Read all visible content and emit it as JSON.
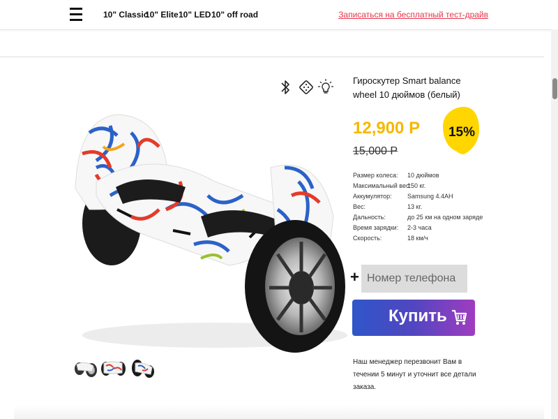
{
  "header": {
    "nav": [
      "10\" Classic",
      "10\" Elite",
      "10\" LED",
      "10\" off road"
    ],
    "cta_link": "Записаться на бесплатный тест-драйв"
  },
  "icons": {
    "menu": "hamburger-menu-icon",
    "features": [
      "bluetooth-icon",
      "remote-control-icon",
      "light-bulb-icon"
    ],
    "cart": "cart-icon"
  },
  "product": {
    "title": "Гироскутер Smart balance wheel 10 дюймов (белый)",
    "price": "12,900 Р",
    "old_price": "15,000 Р",
    "discount": "15%",
    "specs": [
      {
        "label": "Размер колеса:",
        "value": "10 дюймов"
      },
      {
        "label": "Максимальный вес:",
        "value": "150 кг."
      },
      {
        "label": "Аккумулятор:",
        "value": "Samsung 4.4AH"
      },
      {
        "label": "Вес:",
        "value": "13 кг."
      },
      {
        "label": "Дальность:",
        "value": "до 25 км на одном заряде"
      },
      {
        "label": "Время зарядки:",
        "value": "2-3 часа"
      },
      {
        "label": "Скорость:",
        "value": "18 км/ч"
      }
    ]
  },
  "form": {
    "plus": "+",
    "phone_placeholder": "Номер телефона",
    "buy_label": "Купить",
    "note": "Наш менеджер перезвонит Вам в течении 5 минут и уточнит все детали заказа."
  },
  "colors": {
    "accent_price": "#f5b800",
    "badge": "#ffd600",
    "cta_link": "#e8344a",
    "buy_gradient_start": "#2f56c9",
    "buy_gradient_end": "#a03cc0"
  }
}
